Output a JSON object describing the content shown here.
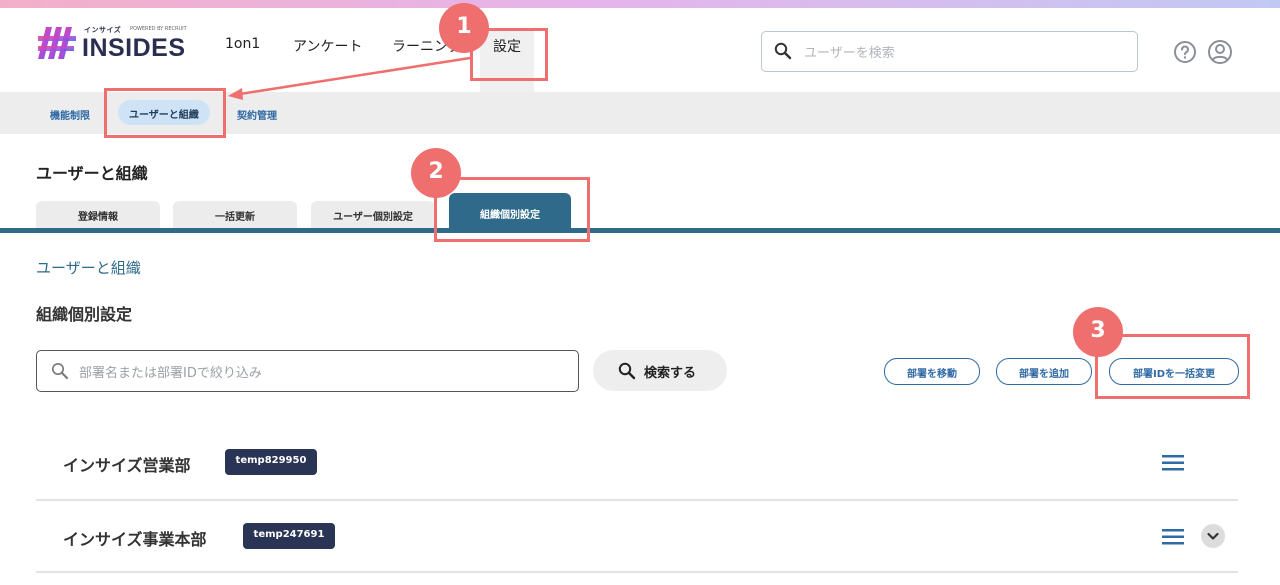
{
  "header": {
    "logo": {
      "small_text": "インサイズ",
      "powered_by": "POWERED BY RECRUIT",
      "name": "INSIDES"
    },
    "nav": [
      {
        "label": "1on1"
      },
      {
        "label": "アンケート"
      },
      {
        "label": "ラーニング"
      },
      {
        "label": "設定"
      }
    ],
    "search_placeholder": "ユーザーを検索"
  },
  "subnav": {
    "items": [
      {
        "label": "機能制限"
      },
      {
        "label": "ユーザーと組織"
      },
      {
        "label": "契約管理"
      }
    ],
    "active_index": 1
  },
  "page": {
    "title": "ユーザーと組織",
    "tabs": [
      {
        "label": "登録情報"
      },
      {
        "label": "一括更新"
      },
      {
        "label": "ユーザー個別設定"
      },
      {
        "label": "組織個別設定"
      }
    ],
    "active_tab": 3,
    "breadcrumb": "ユーザーと組織",
    "section_title": "組織個別設定",
    "filter_placeholder": "部署名または部署IDで絞り込み",
    "search_button": "検索する",
    "actions": [
      {
        "label": "部署を移動"
      },
      {
        "label": "部署を追加"
      },
      {
        "label": "部署IDを一括変更"
      }
    ],
    "departments": [
      {
        "name": "インサイズ営業部",
        "id": "temp829950"
      },
      {
        "name": "インサイズ事業本部",
        "id": "temp247691"
      }
    ]
  },
  "annotations": [
    {
      "number": "1"
    },
    {
      "number": "2"
    },
    {
      "number": "3"
    }
  ],
  "colors": {
    "accent": "#2f6a8a",
    "link": "#2f6aa5",
    "annotation": "#ef6f6f",
    "badge": "#2a3556"
  }
}
